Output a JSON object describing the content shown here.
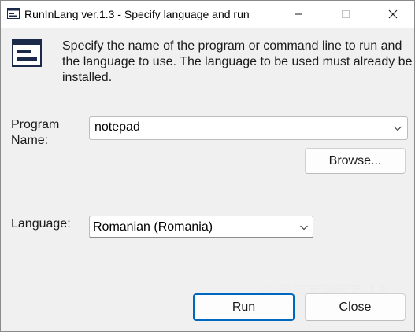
{
  "window": {
    "title": "RunInLang ver.1.3 - Specify language and run"
  },
  "titlebar_buttons": {
    "minimize_icon": "minimize-icon",
    "maximize_icon": "maximize-icon",
    "close_icon": "close-icon"
  },
  "description": "Specify the name of the program or command line to run and the language to use. The language to be used must already be installed.",
  "program": {
    "label": "Program Name:",
    "value": "notepad"
  },
  "browse_label": "Browse...",
  "language": {
    "label": "Language:",
    "selected": "Romanian (Romania)"
  },
  "buttons": {
    "run": "Run",
    "close": "Close"
  },
  "watermark": "SOFTPEDIA",
  "colors": {
    "accent": "#0067c0",
    "background": "#f0f0f0",
    "titlebar": "#ffffff"
  }
}
